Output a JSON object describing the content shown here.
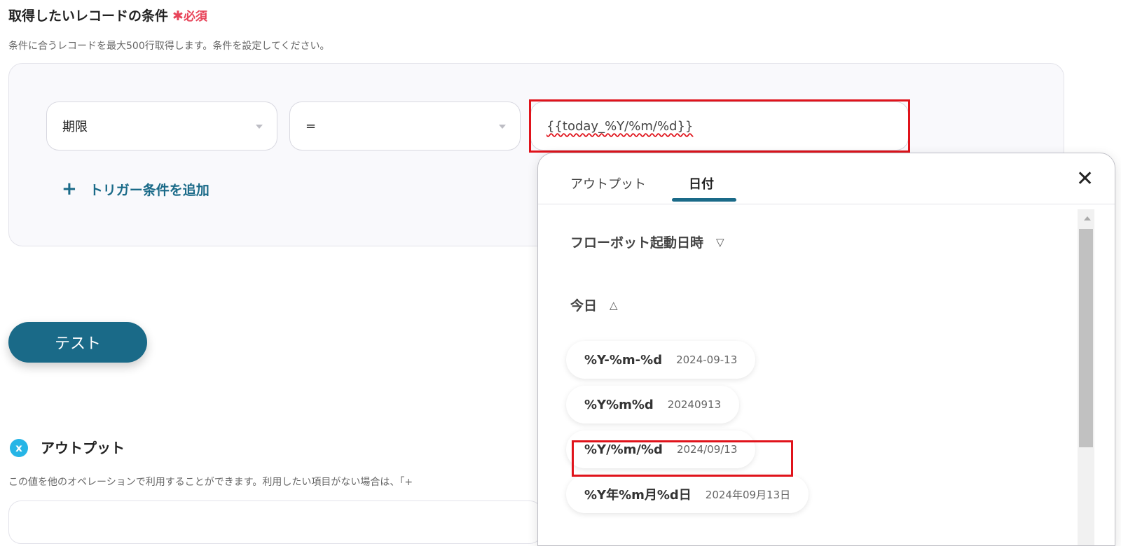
{
  "header": {
    "title": "取得したいレコードの条件",
    "required_star": "✱",
    "required_label": "必須",
    "description": "条件に合うレコードを最大500行取得します。条件を設定してください。"
  },
  "condition": {
    "field_value": "期限",
    "operator_value": "=",
    "value_input": "{{today_%Y/%m/%d}}",
    "add_label": "トリガー条件を追加",
    "add_icon": "+"
  },
  "test_button": "テスト",
  "output": {
    "icon": "x",
    "title": "アウトプット",
    "description": "この値を他のオペレーションで利用することができます。利用したい項目がない場合は、「+"
  },
  "panel": {
    "tabs": [
      "アウトプット",
      "日付"
    ],
    "active_tab": "日付",
    "close_icon": "✕",
    "sections": [
      {
        "label": "フローボット起動日時",
        "expanded": false
      },
      {
        "label": "今日",
        "expanded": true
      }
    ],
    "chev_down": "⌄",
    "chev_up": "⌃",
    "date_formats": [
      {
        "format": "%Y-%m-%d",
        "example": "2024-09-13"
      },
      {
        "format": "%Y%m%d",
        "example": "20240913"
      },
      {
        "format": "%Y/%m/%d",
        "example": "2024/09/13"
      },
      {
        "format": "%Y年%m月%d日",
        "example": "2024年09月13日"
      }
    ]
  },
  "colors": {
    "accent": "#1a6a88",
    "required": "#e8445a",
    "highlight": "#e0131b",
    "output_icon": "#26b5e6"
  }
}
